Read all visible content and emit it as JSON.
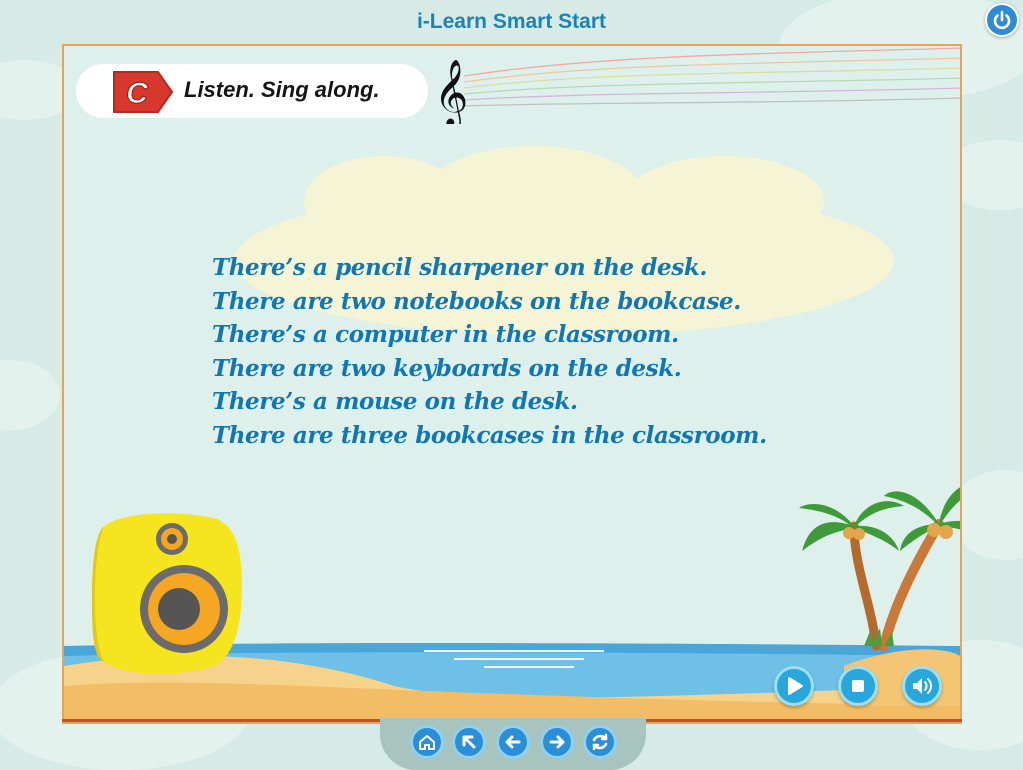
{
  "app": {
    "title": "i-Learn Smart Start"
  },
  "activity": {
    "badge_letter": "C",
    "instruction": "Listen. Sing along."
  },
  "lyrics": [
    "There’s a pencil sharpener on the desk.",
    "There are two notebooks on the bookcase.",
    "There’s a computer in the classroom.",
    "There are two keyboards on the desk.",
    "There’s a mouse on the desk.",
    "There are three bookcases in the classroom."
  ],
  "player_controls": [
    {
      "name": "play-button",
      "icon": "play-icon"
    },
    {
      "name": "stop-button",
      "icon": "stop-icon"
    },
    {
      "name": "volume-button",
      "icon": "volume-icon"
    }
  ],
  "nav_controls": [
    {
      "name": "home-button",
      "icon": "home-icon"
    },
    {
      "name": "back-to-start-button",
      "icon": "up-left-arrow-icon"
    },
    {
      "name": "previous-button",
      "icon": "left-arrow-icon"
    },
    {
      "name": "next-button",
      "icon": "right-arrow-icon"
    },
    {
      "name": "replay-button",
      "icon": "refresh-icon"
    }
  ],
  "colors": {
    "title": "#1a84b8",
    "lyrics": "#1077b3",
    "badge": "#d8382c",
    "frame": "#e8a35a",
    "control_blue": "#29a6dc"
  }
}
